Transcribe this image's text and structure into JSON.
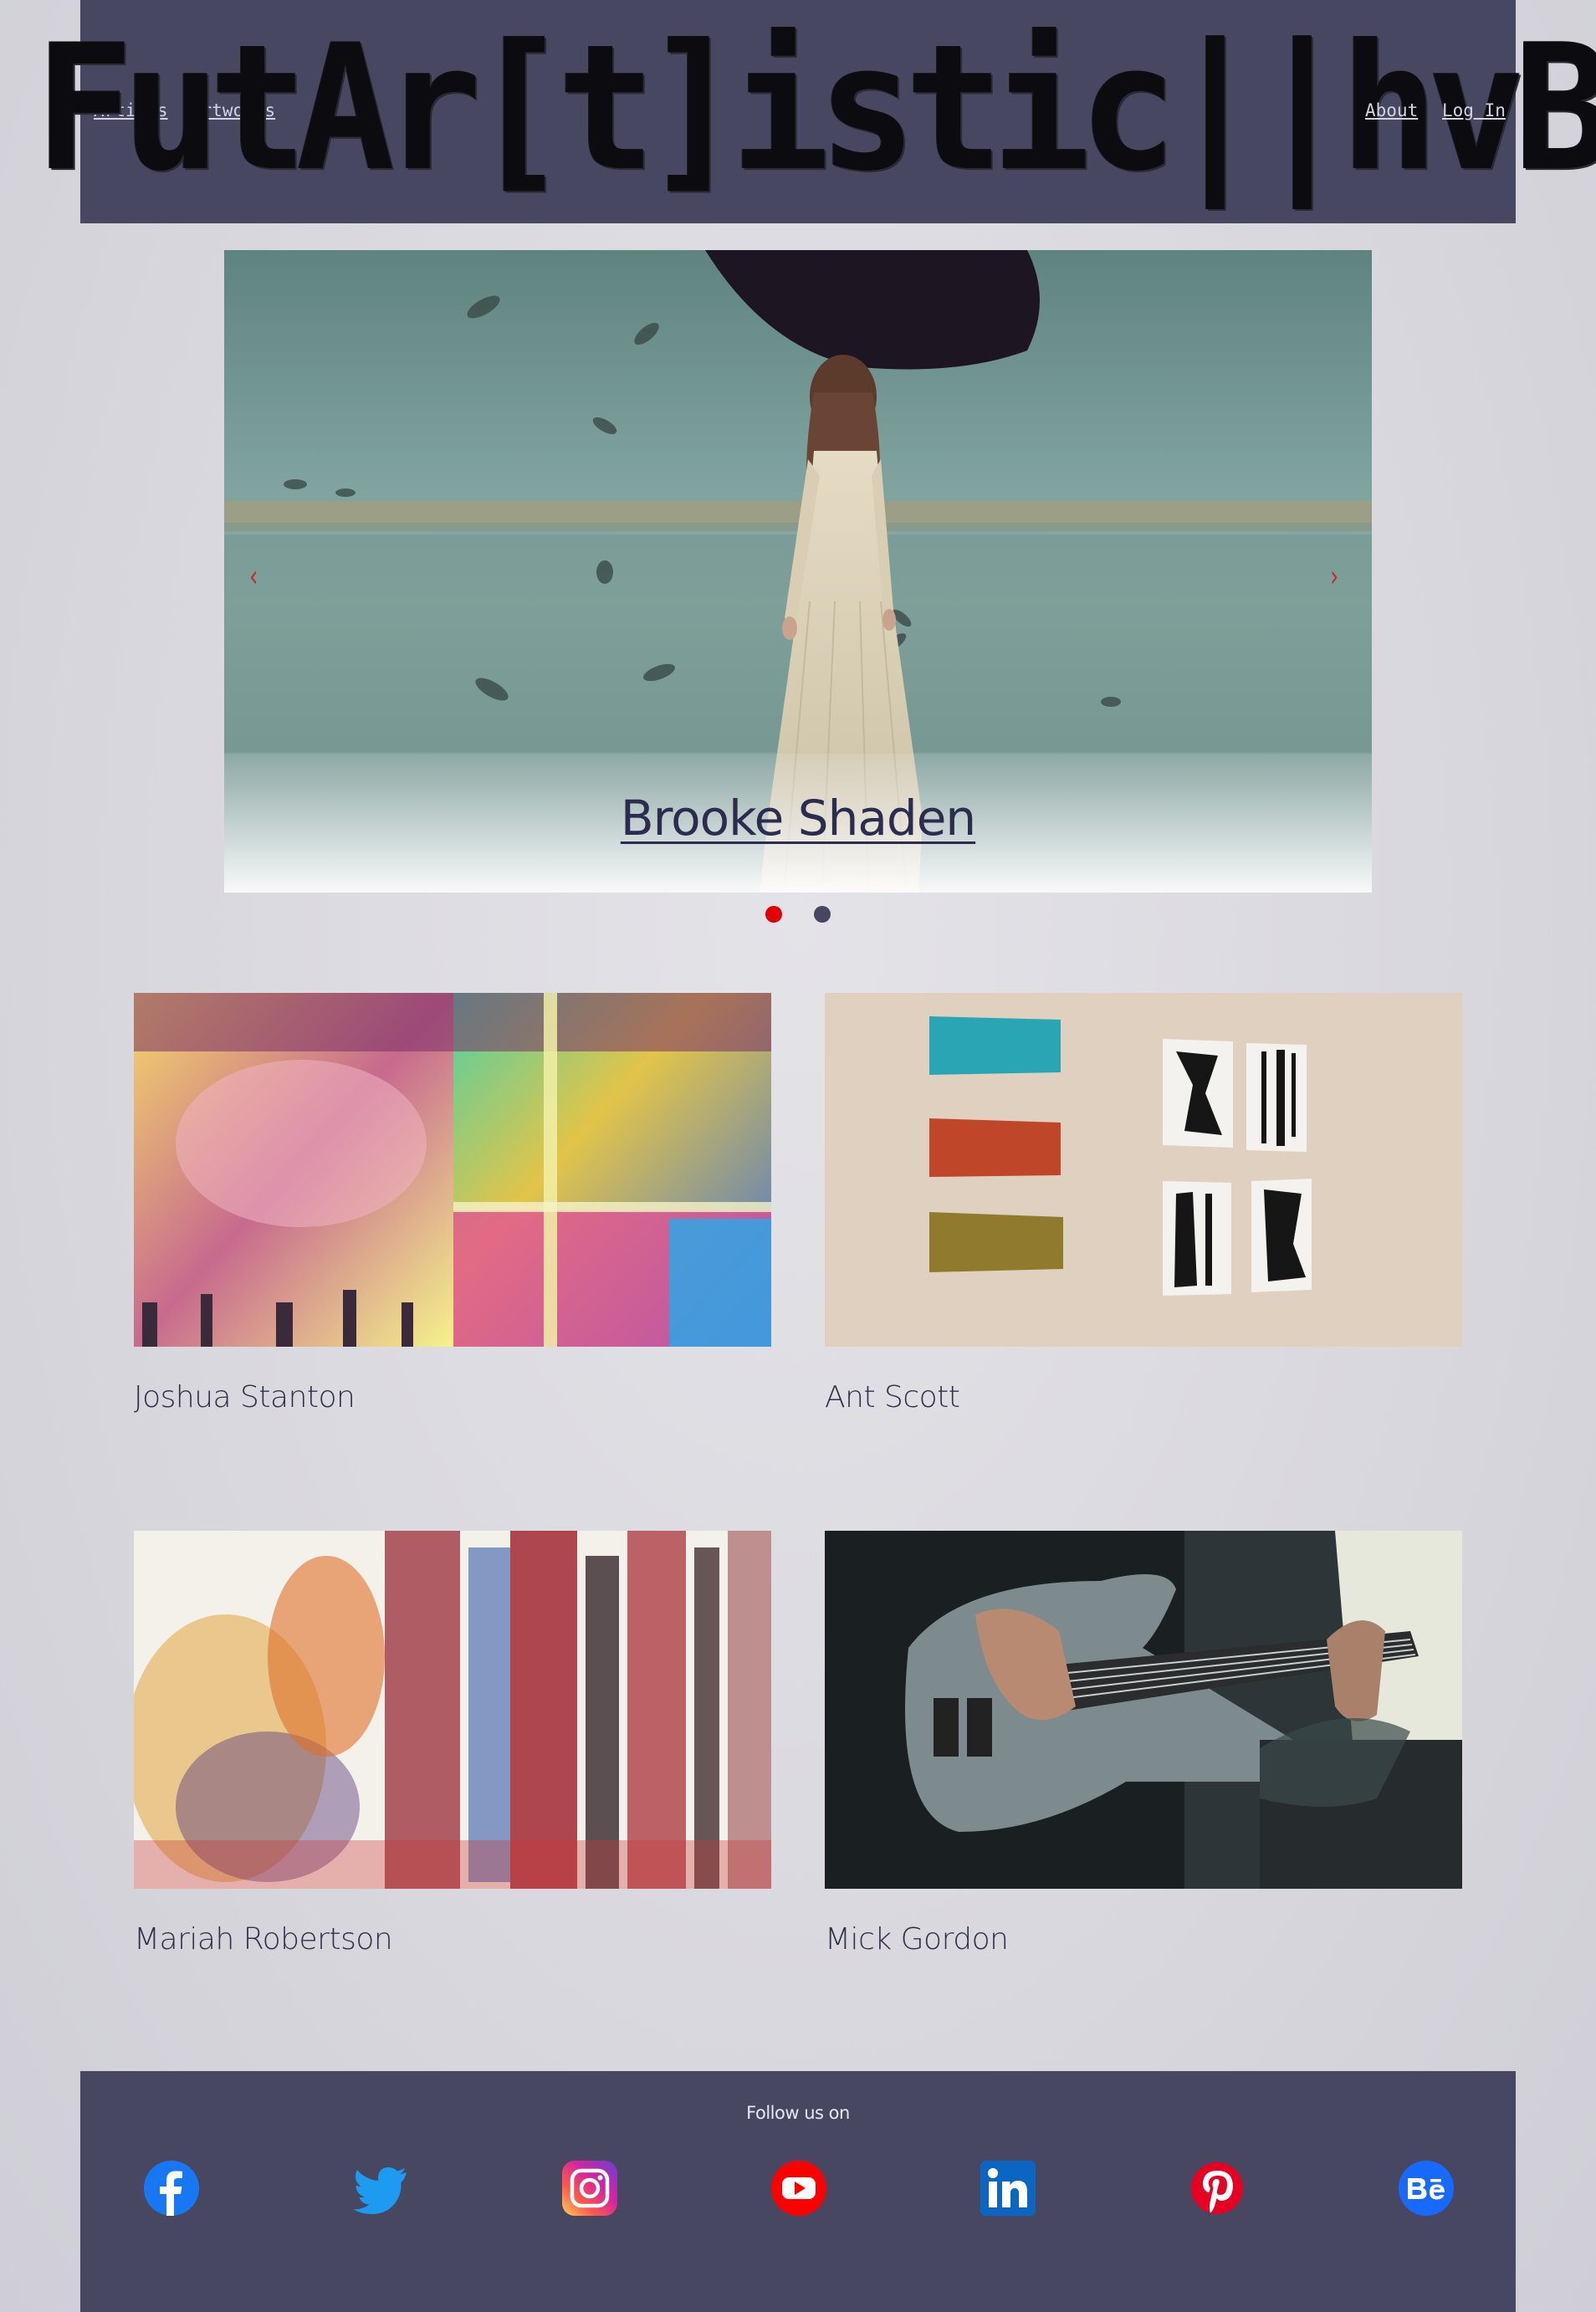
{
  "header": {
    "logo_text": "FutAr[t]istic||hvB",
    "nav_left": [
      "Artists",
      "Artworks"
    ],
    "nav_right": [
      "About",
      "Log In"
    ]
  },
  "slider": {
    "caption": "Brooke Shaden",
    "prev_arrow": "‹",
    "next_arrow": "›",
    "active_dot": 1,
    "dot_count": 2,
    "colors": {
      "arrow": "#c42a2a",
      "dot_active": "#e00000",
      "dot_inactive": "#474762"
    }
  },
  "artists": [
    {
      "name": "Joshua Stanton"
    },
    {
      "name": "Ant Scott"
    },
    {
      "name": "Mariah Robertson"
    },
    {
      "name": "Mick Gordon"
    }
  ],
  "footer": {
    "follow_text": "Follow us on",
    "social": [
      {
        "icon": "facebook-icon",
        "color": "#1877f2"
      },
      {
        "icon": "twitter-icon",
        "color": "#1d9bf0"
      },
      {
        "icon": "instagram-icon",
        "color": "#d6249f"
      },
      {
        "icon": "youtube-icon",
        "color": "#ff0000"
      },
      {
        "icon": "linkedin-icon",
        "color": "#0a66c2"
      },
      {
        "icon": "pinterest-icon",
        "color": "#e60023"
      },
      {
        "icon": "behance-icon",
        "color": "#1769ff"
      }
    ]
  },
  "colors": {
    "header_bg": "#474762",
    "text": "#303049",
    "nav_link": "#d4d3e2"
  }
}
